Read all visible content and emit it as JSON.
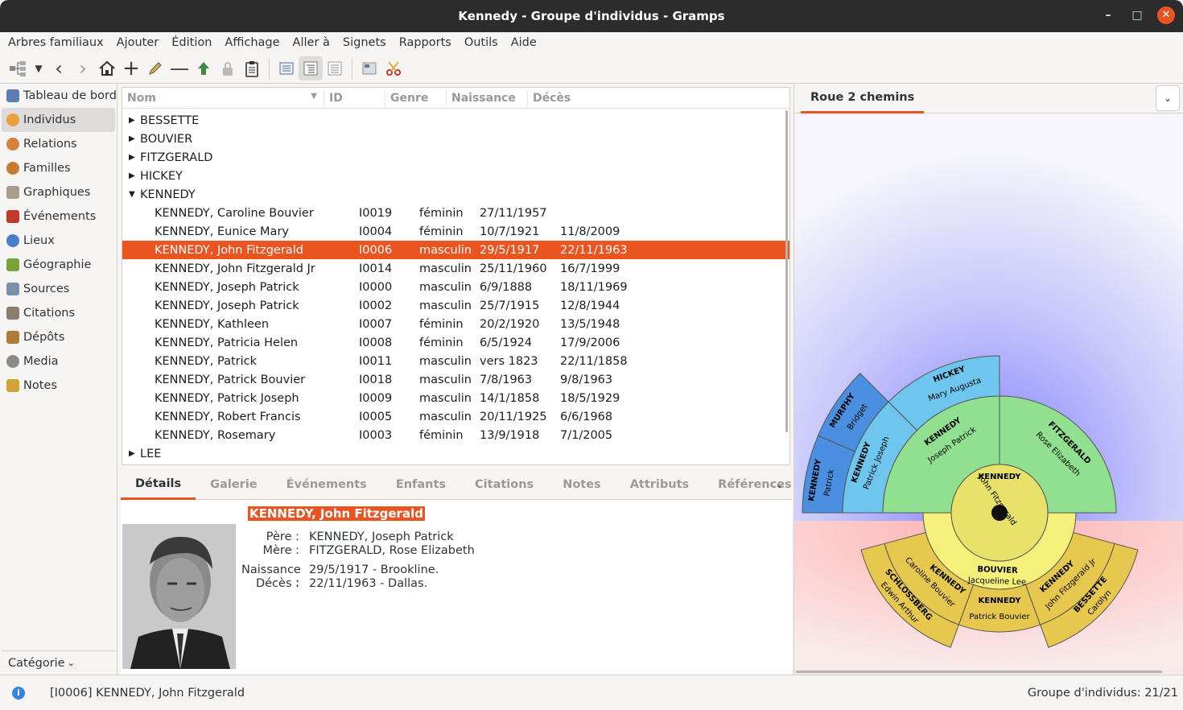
{
  "window": {
    "title": "Kennedy - Groupe d'individus - Gramps",
    "minimize": "–",
    "maximize": "□",
    "close": "✕"
  },
  "menu": [
    "Arbres familiaux",
    "Ajouter",
    "Édition",
    "Affichage",
    "Aller à",
    "Signets",
    "Rapports",
    "Outils",
    "Aide"
  ],
  "sidebar": {
    "items": [
      {
        "label": "Tableau de bord",
        "icon": "dashboard-icon",
        "color": "#5b7fb5"
      },
      {
        "label": "Individus",
        "icon": "people-icon",
        "color": "#e8a23c",
        "active": true
      },
      {
        "label": "Relations",
        "icon": "relations-icon",
        "color": "#d9803a"
      },
      {
        "label": "Familles",
        "icon": "families-icon",
        "color": "#c87a33"
      },
      {
        "label": "Graphiques",
        "icon": "charts-icon",
        "color": "#a89c8c"
      },
      {
        "label": "Événements",
        "icon": "events-icon",
        "color": "#c0392b"
      },
      {
        "label": "Lieux",
        "icon": "places-icon",
        "color": "#4a7cc9"
      },
      {
        "label": "Géographie",
        "icon": "geography-icon",
        "color": "#7aa33b"
      },
      {
        "label": "Sources",
        "icon": "sources-icon",
        "color": "#7a8fa8"
      },
      {
        "label": "Citations",
        "icon": "citations-icon",
        "color": "#8c7d6e"
      },
      {
        "label": "Dépôts",
        "icon": "repositories-icon",
        "color": "#b07a3a"
      },
      {
        "label": "Media",
        "icon": "media-icon",
        "color": "#8a8a8a"
      },
      {
        "label": "Notes",
        "icon": "notes-icon",
        "color": "#d2a23a"
      }
    ],
    "category": "Catégorie"
  },
  "list": {
    "headers": {
      "name": "Nom",
      "id": "ID",
      "gender": "Genre",
      "birth": "Naissance",
      "death": "Décès"
    },
    "groups_before": [
      "BESSETTE",
      "BOUVIER",
      "FITZGERALD",
      "HICKEY"
    ],
    "open_group": "KENNEDY",
    "rows": [
      {
        "name": "KENNEDY, Caroline Bouvier",
        "id": "I0019",
        "gender": "féminin",
        "birth": "27/11/1957",
        "death": ""
      },
      {
        "name": "KENNEDY, Eunice Mary",
        "id": "I0004",
        "gender": "féminin",
        "birth": "10/7/1921",
        "death": "11/8/2009"
      },
      {
        "name": "KENNEDY, John Fitzgerald",
        "id": "I0006",
        "gender": "masculin",
        "birth": "29/5/1917",
        "death": "22/11/1963",
        "selected": true
      },
      {
        "name": "KENNEDY, John Fitzgerald Jr",
        "id": "I0014",
        "gender": "masculin",
        "birth": "25/11/1960",
        "death": "16/7/1999"
      },
      {
        "name": "KENNEDY, Joseph Patrick",
        "id": "I0000",
        "gender": "masculin",
        "birth": "6/9/1888",
        "death": "18/11/1969"
      },
      {
        "name": "KENNEDY, Joseph Patrick",
        "id": "I0002",
        "gender": "masculin",
        "birth": "25/7/1915",
        "death": "12/8/1944"
      },
      {
        "name": "KENNEDY, Kathleen",
        "id": "I0007",
        "gender": "féminin",
        "birth": "20/2/1920",
        "death": "13/5/1948"
      },
      {
        "name": "KENNEDY, Patricia Helen",
        "id": "I0008",
        "gender": "féminin",
        "birth": "6/5/1924",
        "death": "17/9/2006"
      },
      {
        "name": "KENNEDY, Patrick",
        "id": "I0011",
        "gender": "masculin",
        "birth": "vers 1823",
        "death": "22/11/1858"
      },
      {
        "name": "KENNEDY, Patrick Bouvier",
        "id": "I0018",
        "gender": "masculin",
        "birth": "7/8/1963",
        "death": "9/8/1963"
      },
      {
        "name": "KENNEDY, Patrick Joseph",
        "id": "I0009",
        "gender": "masculin",
        "birth": "14/1/1858",
        "death": "18/5/1929"
      },
      {
        "name": "KENNEDY, Robert Francis",
        "id": "I0005",
        "gender": "masculin",
        "birth": "20/11/1925",
        "death": "6/6/1968"
      },
      {
        "name": "KENNEDY, Rosemary",
        "id": "I0003",
        "gender": "féminin",
        "birth": "13/9/1918",
        "death": "7/1/2005"
      }
    ],
    "groups_after": [
      "LEE"
    ]
  },
  "bottom_tabs": [
    "Détails",
    "Galerie",
    "Événements",
    "Enfants",
    "Citations",
    "Notes",
    "Attributs",
    "Références"
  ],
  "details": {
    "name": "KENNEDY, John Fitzgerald",
    "father_label": "Père :",
    "father": "KENNEDY, Joseph Patrick",
    "mother_label": "Mère :",
    "mother": "FITZGERALD, Rose Elizabeth",
    "birth_label": "Naissance :",
    "birth": "29/5/1917 - Brookline.",
    "death_label": "Décès :",
    "death": "22/11/1963 - Dallas."
  },
  "right_pane": {
    "tab": "Roue 2 chemins",
    "chart": {
      "center": {
        "surname": "KENNEDY",
        "given": "John Fitzgerald"
      },
      "ancestors": [
        {
          "surname": "KENNEDY",
          "given": "Joseph Patrick",
          "color": "#90e090"
        },
        {
          "surname": "FITZGERALD",
          "given": "Rose Elizabeth",
          "color": "#90e090"
        },
        {
          "surname": "KENNEDY",
          "given": "Patrick Joseph",
          "color": "#6ec6ee"
        },
        {
          "surname": "HICKEY",
          "given": "Mary Augusta",
          "color": "#6ec6ee"
        },
        {
          "surname": "KENNEDY",
          "given": "Patrick",
          "color": "#4a8fe0"
        },
        {
          "surname": "MURPHY",
          "given": "Bridget",
          "color": "#4a8fe0"
        }
      ],
      "descendants": [
        {
          "surname": "BOUVIER",
          "given": "Jacqueline Lee",
          "color": "#f5f07a"
        },
        {
          "surname": "KENNEDY",
          "given": "Caroline Bouvier",
          "color": "#e6c84e"
        },
        {
          "surname": "KENNEDY",
          "given": "Patrick Bouvier",
          "color": "#e6c84e"
        },
        {
          "surname": "KENNEDY",
          "given": "John Fitzgerald Jr",
          "color": "#e6c84e"
        },
        {
          "surname": "SCHLOSSBERG",
          "given": "Edwin Arthur",
          "color": "#e6c84e"
        },
        {
          "surname": "BESSETTE",
          "given": "Carolyn",
          "color": "#e6c84e"
        }
      ]
    }
  },
  "status": {
    "left": "[I0006] KENNEDY, John Fitzgerald",
    "right": "Groupe d'individus: 21/21"
  }
}
